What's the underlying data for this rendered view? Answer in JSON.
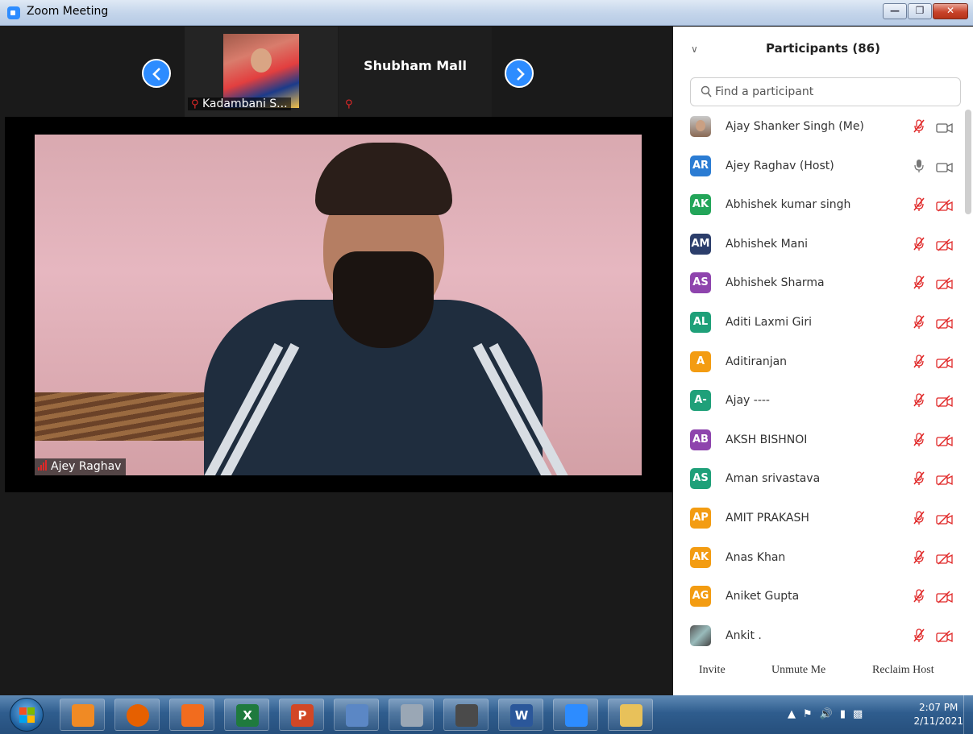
{
  "window": {
    "title": "Zoom Meeting"
  },
  "gallery_strip": {
    "tile1_name": "Kadambani S...",
    "tile2_name": "Shubham Mall"
  },
  "active_speaker": {
    "name": "Ajey Raghav"
  },
  "participants": {
    "title": "Participants (86)",
    "search_placeholder": "Find a participant",
    "items": [
      {
        "initials": "",
        "name": "Ajay Shanker Singh (Me)",
        "color": "",
        "avatar": "photo",
        "mic": "muted",
        "video": "on"
      },
      {
        "initials": "AR",
        "name": "Ajey Raghav (Host)",
        "color": "#2b7cd3",
        "avatar": "initials",
        "mic": "on",
        "video": "on"
      },
      {
        "initials": "AK",
        "name": "Abhishek kumar singh",
        "color": "#23a559",
        "avatar": "initials",
        "mic": "muted",
        "video": "off"
      },
      {
        "initials": "AM",
        "name": "Abhishek Mani",
        "color": "#2c3e6b",
        "avatar": "initials",
        "mic": "muted",
        "video": "off"
      },
      {
        "initials": "AS",
        "name": "Abhishek Sharma",
        "color": "#8e44ad",
        "avatar": "initials",
        "mic": "muted",
        "video": "off"
      },
      {
        "initials": "AL",
        "name": "Aditi Laxmi Giri",
        "color": "#1fa079",
        "avatar": "initials",
        "mic": "muted",
        "video": "off"
      },
      {
        "initials": "A",
        "name": "Aditiranjan",
        "color": "#f39c12",
        "avatar": "initials",
        "mic": "muted",
        "video": "off"
      },
      {
        "initials": "A-",
        "name": "Ajay ----",
        "color": "#1fa079",
        "avatar": "initials",
        "mic": "muted",
        "video": "off"
      },
      {
        "initials": "AB",
        "name": "AKSH BISHNOI",
        "color": "#8e44ad",
        "avatar": "initials",
        "mic": "muted",
        "video": "off"
      },
      {
        "initials": "AS",
        "name": "Aman srivastava",
        "color": "#1fa079",
        "avatar": "initials",
        "mic": "muted",
        "video": "off"
      },
      {
        "initials": "AP",
        "name": "AMIT PRAKASH",
        "color": "#f39c12",
        "avatar": "initials",
        "mic": "muted",
        "video": "off"
      },
      {
        "initials": "AK",
        "name": "Anas Khan",
        "color": "#f39c12",
        "avatar": "initials",
        "mic": "muted",
        "video": "off"
      },
      {
        "initials": "AG",
        "name": "Aniket Gupta",
        "color": "#f39c12",
        "avatar": "initials",
        "mic": "muted",
        "video": "off"
      },
      {
        "initials": "",
        "name": "Ankit .",
        "color": "",
        "avatar": "photo2",
        "mic": "muted",
        "video": "off"
      }
    ],
    "buttons": {
      "invite": "Invite",
      "unmute": "Unmute Me",
      "reclaim": "Reclaim Host"
    }
  },
  "taskbar": {
    "apps": [
      {
        "name": "video-player-icon",
        "label": "",
        "color": "#f08a24"
      },
      {
        "name": "firefox-icon",
        "label": "",
        "color": "#e66000"
      },
      {
        "name": "avast-icon",
        "label": "",
        "color": "#f26c1e"
      },
      {
        "name": "excel-icon",
        "label": "X",
        "color": "#1f7a3e"
      },
      {
        "name": "powerpoint-icon",
        "label": "P",
        "color": "#d24726"
      },
      {
        "name": "notebook-icon",
        "label": "",
        "color": "#5b87c5"
      },
      {
        "name": "calculator-icon",
        "label": "",
        "color": "#9aa7b5"
      },
      {
        "name": "scanner-icon",
        "label": "",
        "color": "#4a4a4a"
      },
      {
        "name": "word-icon",
        "label": "W",
        "color": "#2b579a"
      },
      {
        "name": "zoom-icon",
        "label": "",
        "color": "#2d8cff"
      },
      {
        "name": "folder-icon",
        "label": "",
        "color": "#e8c15a"
      }
    ],
    "clock_time": "2:07 PM",
    "clock_date": "2/11/2021"
  }
}
